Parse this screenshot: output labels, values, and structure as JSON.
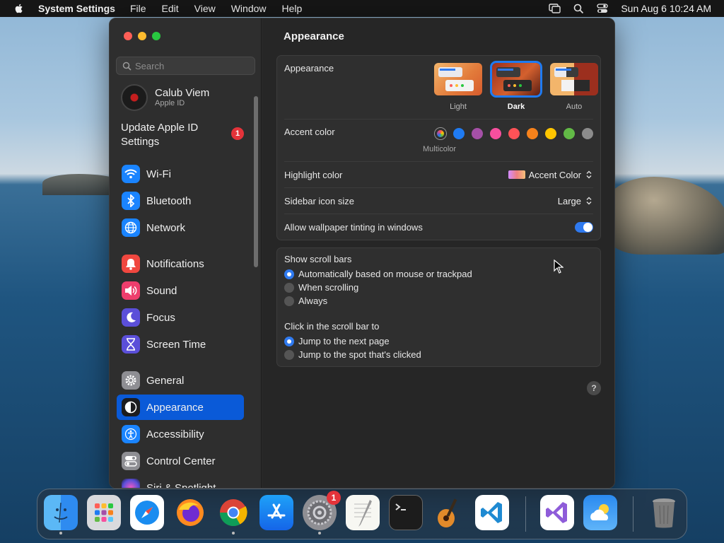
{
  "menubar": {
    "app_name": "System Settings",
    "menus": [
      "File",
      "Edit",
      "View",
      "Window",
      "Help"
    ],
    "clock": "Sun Aug 6  10:24 AM"
  },
  "sidebar": {
    "search_placeholder": "Search",
    "user": {
      "name": "Calub Viem",
      "subtitle": "Apple ID"
    },
    "update": {
      "label": "Update Apple ID Settings",
      "badge": "1"
    },
    "items": [
      {
        "label": "Wi-Fi",
        "icon": "wifi-icon",
        "color": "#1a84ff"
      },
      {
        "label": "Bluetooth",
        "icon": "bluetooth-icon",
        "color": "#1a84ff"
      },
      {
        "label": "Network",
        "icon": "globe-icon",
        "color": "#1a84ff"
      },
      {
        "label": "Notifications",
        "icon": "bell-icon",
        "color": "#f0473f"
      },
      {
        "label": "Sound",
        "icon": "speaker-icon",
        "color": "#ee3e6d"
      },
      {
        "label": "Focus",
        "icon": "moon-icon",
        "color": "#5b4fd9"
      },
      {
        "label": "Screen Time",
        "icon": "hourglass-icon",
        "color": "#5b4fd9"
      },
      {
        "label": "General",
        "icon": "gear-icon",
        "color": "#8e8e93"
      },
      {
        "label": "Appearance",
        "icon": "appearance-icon",
        "color": "#1c1c1e",
        "active": true
      },
      {
        "label": "Accessibility",
        "icon": "accessibility-icon",
        "color": "#1a84ff"
      },
      {
        "label": "Control Center",
        "icon": "control-center-icon",
        "color": "#8e8e93"
      },
      {
        "label": "Siri & Spotlight",
        "icon": "siri-icon",
        "color": "#c042e0"
      }
    ]
  },
  "main": {
    "title": "Appearance",
    "appearance": {
      "label": "Appearance",
      "options": [
        "Light",
        "Dark",
        "Auto"
      ],
      "selected": "Dark"
    },
    "accent": {
      "label": "Accent color",
      "colors": [
        "multicolor",
        "#1f7bf2",
        "#a550a7",
        "#f74f9e",
        "#ff5257",
        "#f7821b",
        "#ffc600",
        "#62ba46",
        "#8c8c8c"
      ],
      "multicolor_label": "Multicolor"
    },
    "highlight": {
      "label": "Highlight color",
      "value": "Accent Color"
    },
    "sidebar_icon_size": {
      "label": "Sidebar icon size",
      "value": "Large"
    },
    "wallpaper_tinting": {
      "label": "Allow wallpaper tinting in windows",
      "on": true
    },
    "scroll_bars": {
      "title": "Show scroll bars",
      "options": [
        "Automatically based on mouse or trackpad",
        "When scrolling",
        "Always"
      ],
      "selected": 0
    },
    "click_scroll": {
      "title": "Click in the scroll bar to",
      "options": [
        "Jump to the next page",
        "Jump to the spot that's clicked"
      ],
      "selected": 0
    },
    "help": "?"
  },
  "dock": {
    "apps": [
      "Finder",
      "Launchpad",
      "Safari",
      "Firefox",
      "Chrome",
      "App Store",
      "System Settings",
      "TextEdit",
      "Terminal",
      "GarageBand",
      "Visual Studio Code",
      "Visual Studio",
      "Weather",
      "Trash"
    ],
    "settings_badge": "1"
  }
}
